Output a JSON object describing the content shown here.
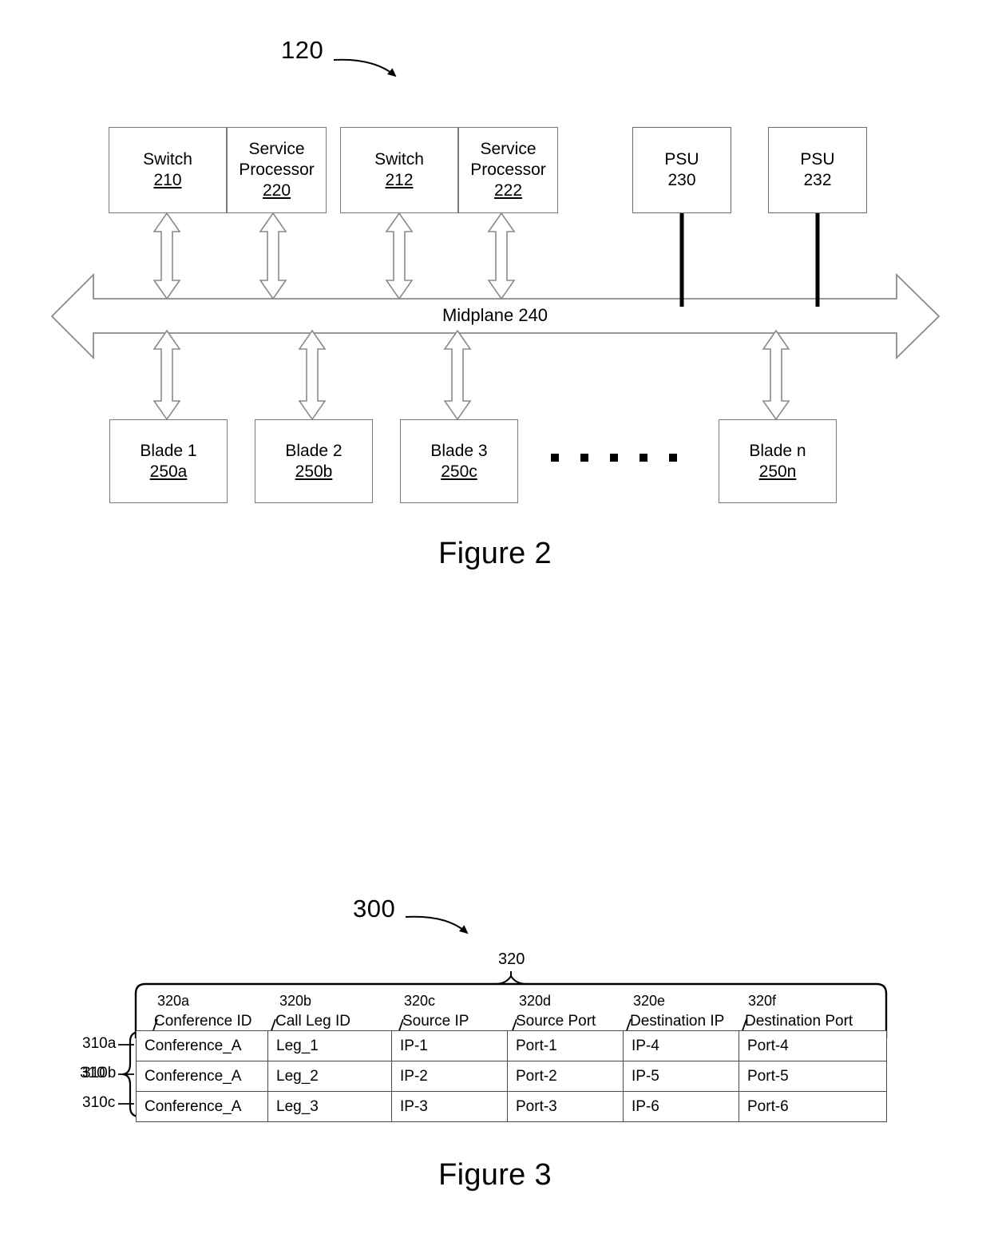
{
  "document": {
    "kind": "patent-drawing-sheet",
    "figures": [
      "Figure 2",
      "Figure 3"
    ]
  },
  "figure2": {
    "caption": "Figure 2",
    "system_ref": "120",
    "midplane": {
      "label": "Midplane 240"
    },
    "top_modules": [
      {
        "name": "switch-1",
        "line1": "Switch",
        "line2": "210",
        "underline": true
      },
      {
        "name": "service-processor-1",
        "line1": "Service\nProcessor",
        "line2": "220",
        "underline": true
      },
      {
        "name": "switch-2",
        "line1": "Switch",
        "line2": "212",
        "underline": true
      },
      {
        "name": "service-processor-2",
        "line1": "Service\nProcessor",
        "line2": "222",
        "underline": true
      },
      {
        "name": "psu-1",
        "line1": "PSU",
        "line2": "230",
        "underline": false
      },
      {
        "name": "psu-2",
        "line1": "PSU",
        "line2": "232",
        "underline": false
      }
    ],
    "blades": [
      {
        "name": "blade-1",
        "line1": "Blade 1",
        "line2": "250a"
      },
      {
        "name": "blade-2",
        "line1": "Blade 2",
        "line2": "250b"
      },
      {
        "name": "blade-3",
        "line1": "Blade 3",
        "line2": "250c"
      },
      {
        "name": "blade-n",
        "line1": "Blade n",
        "line2": "250n"
      }
    ],
    "ellipsis_dots": 5
  },
  "figure3": {
    "caption": "Figure 3",
    "table_ref": "300",
    "header_group_ref": "320",
    "row_group_ref": "310",
    "column_refs": [
      "320a",
      "320b",
      "320c",
      "320d",
      "320e",
      "320f"
    ],
    "columns": [
      "Conference ID",
      "Call Leg ID",
      "Source IP",
      "Source Port",
      "Destination IP",
      "Destination Port"
    ],
    "row_refs": [
      "310a",
      "310b",
      "310c"
    ],
    "rows": [
      [
        "Conference_A",
        "Leg_1",
        "IP-1",
        "Port-1",
        "IP-4",
        "Port-4"
      ],
      [
        "Conference_A",
        "Leg_2",
        "IP-2",
        "Port-2",
        "IP-5",
        "Port-5"
      ],
      [
        "Conference_A",
        "Leg_3",
        "IP-3",
        "Port-3",
        "IP-6",
        "Port-6"
      ]
    ]
  },
  "chart_data": {
    "type": "table",
    "title": "Figure 3",
    "columns": [
      "Conference ID",
      "Call Leg ID",
      "Source IP",
      "Source Port",
      "Destination IP",
      "Destination Port"
    ],
    "rows": [
      [
        "Conference_A",
        "Leg_1",
        "IP-1",
        "Port-1",
        "IP-4",
        "Port-4"
      ],
      [
        "Conference_A",
        "Leg_2",
        "IP-2",
        "Port-2",
        "IP-5",
        "Port-5"
      ],
      [
        "Conference_A",
        "Leg_3",
        "IP-3",
        "Port-3",
        "IP-6",
        "Port-6"
      ]
    ]
  },
  "colors": {
    "ink": "#000000",
    "box_stroke": "#7a7a7a",
    "table_stroke": "#4a4a4a",
    "background": "#ffffff"
  }
}
